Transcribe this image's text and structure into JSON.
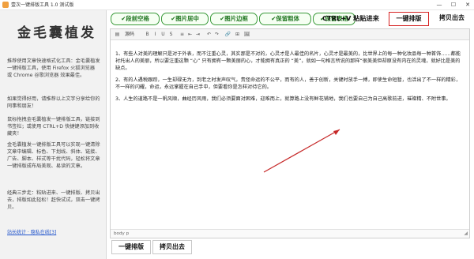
{
  "window": {
    "title": "壹次一键排版工具 1.0 测试版",
    "controls": {
      "minimize": "—",
      "maximize": "☐",
      "close": "✕"
    }
  },
  "sidebar": {
    "logo": "金毛囊植发",
    "p1": "推荐使用文章快速格式化工具：金毛囊植发一键排版工具，使用 Firefox 火狐浏览器 或 Chrome 谷歌浏览器 效果最佳。",
    "p2": "如果觉得好用，请推荐以上文字分享给你的同事和朋友！",
    "p3": "鼠标拖拽金毛囊植发一键排版工具，链接到书签栏；或使用 CTRL+D 快捷键添加到收藏夹！",
    "p4": "金毛囊植发一键排版工具可以实现一键清除文章中编辑、标色、下划线、斜体、链接、广告、脚本、样式等干扰代码，轻松将文章一键排版成布局美观、易读的文章。",
    "p5": "经典三步走：粘贴进来、一键排版、拷贝出去，排版如此轻松！赶快试试，双击一键拷贝。",
    "links": "站长统计 · 隐私在线[3]"
  },
  "toolbar": {
    "options": [
      "✔段前空格",
      "✔图片居中",
      "✔图片边框",
      "✔保留粗体",
      "✔保留表格"
    ],
    "paste_label": "CTRL+V 粘贴进来",
    "onekey_label": "一键排版",
    "copy_label": "拷贝出去"
  },
  "editor": {
    "source_label": "源码",
    "toolbar_icons": [
      "B",
      "I",
      "U",
      "S",
      "≡",
      "⇤",
      "⇥",
      "↶",
      "↷",
      "🔗",
      "⊞",
      "🖼"
    ],
    "paragraphs": [
      "1、有些人对美的理解只是对于外表，而不注重心灵，其实那是不对的，心灵才是人最佳的名片，心灵才是最美的，比世界上的每一种化妆品每一种首饰……都能衬托出人的美丽，所以要注重这颗 “心” 只有拥有一颗美丽的心，才能拥有真正的 “美”，就如一句格言所说的那样“很美美但却原没有内在的灵魂，就好比是美的缺点。",
      "2、有的人遇税跟踪，一生却碌无为，到老之时发声叹气，责怪命运的不公平，而有的人，善于创新，关键时放手一搏，即使生命短暂，也活出了不一样的精彩，不一样的闪耀，命运，永远掌握在自己手中，但要看你是怎样对待它的。",
      "3、人生的道路不是一帆风顺，曲经历风雨，我们必须要面对困难，迎难而上，就算路上没有鲜花铺地，我们也要自己为自己高歌前进，璀璨精、不附世事。"
    ],
    "status": "body  p"
  },
  "bottom": {
    "onekey_label": "一键排版",
    "copy_label": "拷贝出去"
  },
  "colors": {
    "accent_red": "#d62222",
    "option_green": "#3a9a3a"
  }
}
